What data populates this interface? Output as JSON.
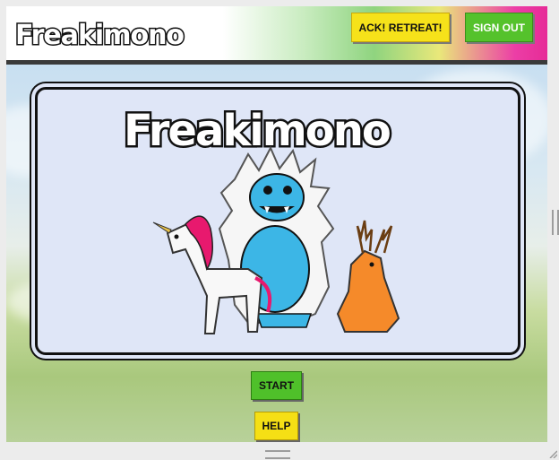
{
  "header": {
    "logo_text": "Freakimono",
    "retreat_label": "ACK! RETREAT!",
    "signout_label": "SIGN OUT"
  },
  "splash": {
    "logo_text": "Freakimono",
    "illustration": "unicorn, yeti and jackalope creatures"
  },
  "actions": {
    "start_label": "START",
    "help_label": "HELP"
  },
  "colors": {
    "retreat": "#f6e21a",
    "signout": "#55c22c",
    "start": "#4fc02a",
    "help": "#f5df15",
    "header_accent": "#e62b97"
  }
}
